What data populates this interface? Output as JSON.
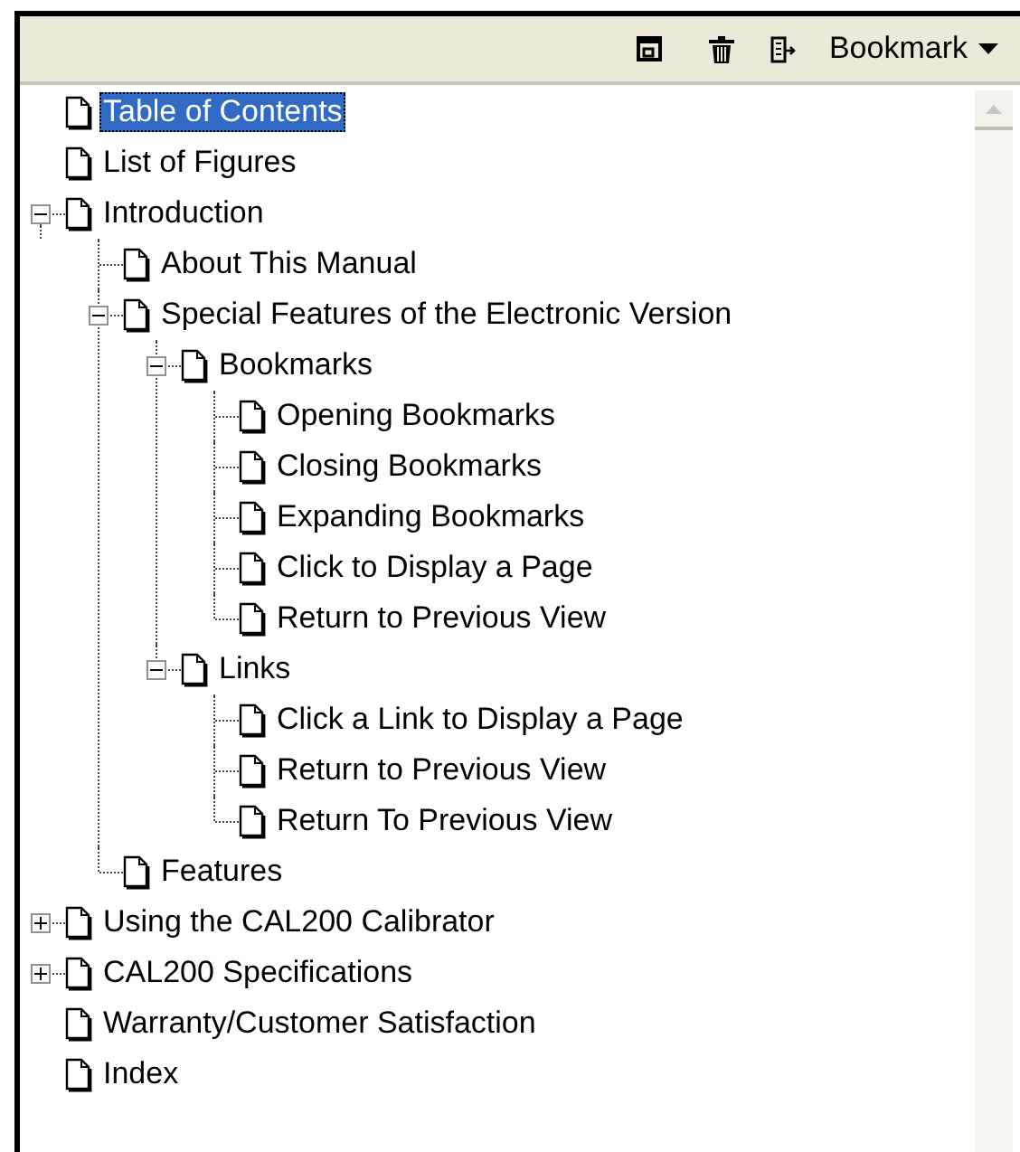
{
  "toolbar": {
    "menu_label": "Bookmark"
  },
  "tree": [
    {
      "label": "Table of Contents",
      "selected": true
    },
    {
      "label": "List of Figures",
      "selected": false
    },
    {
      "label": "Introduction",
      "selected": false,
      "expanded": true,
      "children": [
        {
          "label": "About This Manual",
          "selected": false
        },
        {
          "label": "Special Features of the Electronic Version",
          "selected": false,
          "expanded": true,
          "children": [
            {
              "label": "Bookmarks",
              "selected": false,
              "expanded": true,
              "children": [
                {
                  "label": "Opening Bookmarks",
                  "selected": false
                },
                {
                  "label": "Closing Bookmarks",
                  "selected": false
                },
                {
                  "label": "Expanding Bookmarks",
                  "selected": false
                },
                {
                  "label": "Click to Display a Page",
                  "selected": false
                },
                {
                  "label": "Return to Previous View",
                  "selected": false
                }
              ]
            },
            {
              "label": "Links",
              "selected": false,
              "expanded": true,
              "children": [
                {
                  "label": "Click a Link to Display a Page",
                  "selected": false
                },
                {
                  "label": "Return to Previous View",
                  "selected": false
                },
                {
                  "label": "Return To Previous View",
                  "selected": false
                }
              ]
            }
          ]
        },
        {
          "label": "Features",
          "selected": false
        }
      ]
    },
    {
      "label": "Using the CAL200 Calibrator",
      "selected": false,
      "expanded": false
    },
    {
      "label": "CAL200 Specifications",
      "selected": false,
      "expanded": false
    },
    {
      "label": "Warranty/Customer Satisfaction",
      "selected": false
    },
    {
      "label": "Index",
      "selected": false
    }
  ]
}
